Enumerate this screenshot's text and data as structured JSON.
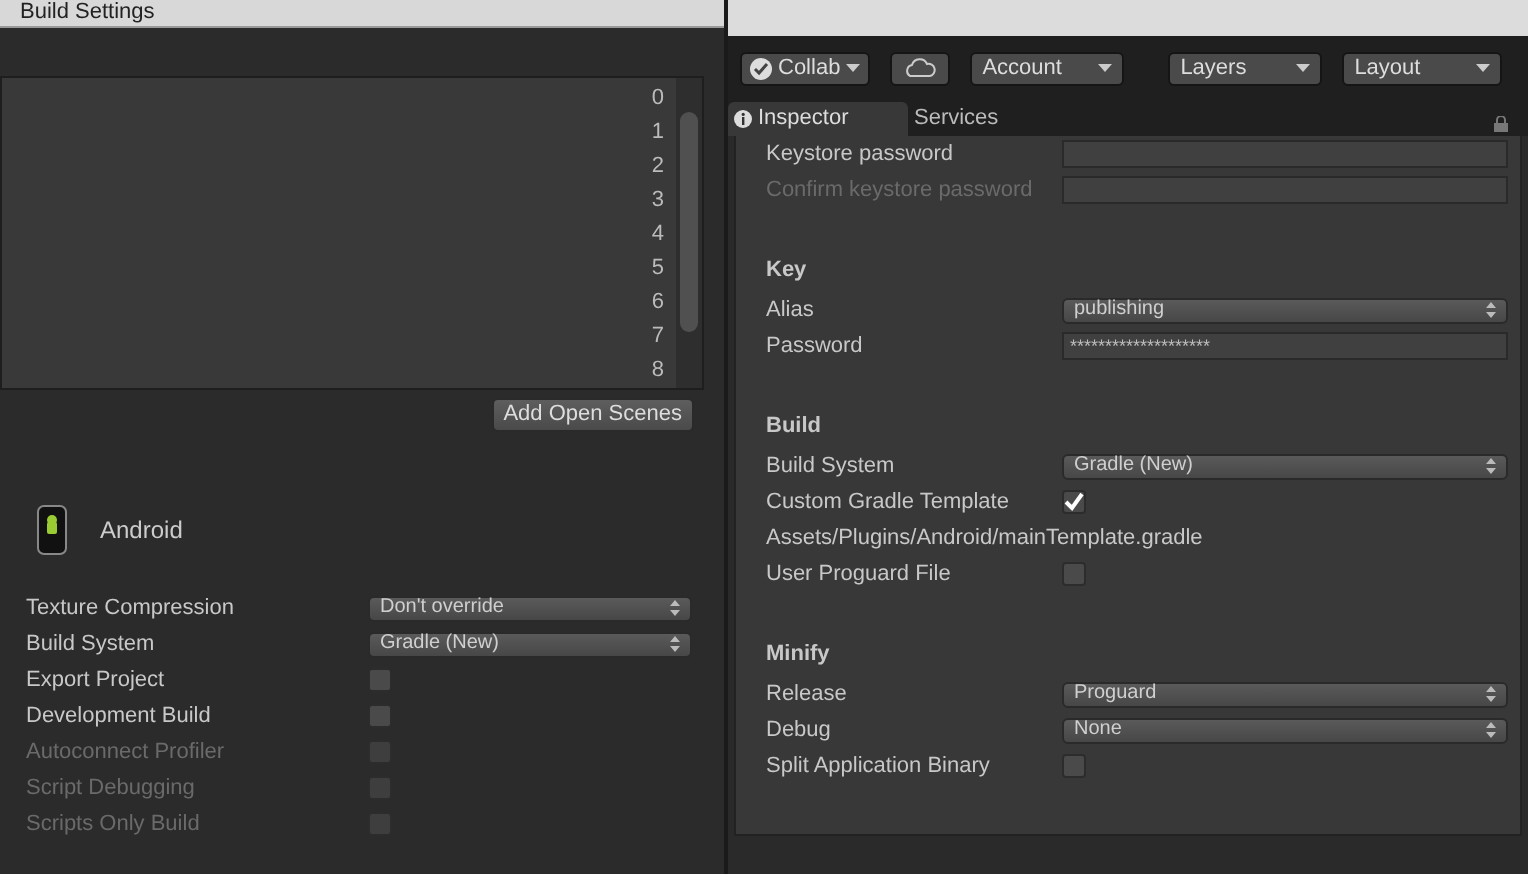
{
  "build_settings": {
    "title": "Build Settings",
    "scene_indices": [
      "0",
      "1",
      "2",
      "3",
      "4",
      "5",
      "6",
      "7",
      "8"
    ],
    "add_open_scenes": "Add Open Scenes",
    "platform": "Android",
    "rows": [
      {
        "kind": "dropdown",
        "label": "Texture Compression",
        "value": "Don't override",
        "disabled": false
      },
      {
        "kind": "dropdown",
        "label": "Build System",
        "value": "Gradle (New)",
        "disabled": false
      },
      {
        "kind": "checkbox",
        "label": "Export Project",
        "checked": false,
        "disabled": false
      },
      {
        "kind": "checkbox",
        "label": "Development Build",
        "checked": false,
        "disabled": false
      },
      {
        "kind": "checkbox",
        "label": "Autoconnect Profiler",
        "checked": false,
        "disabled": true
      },
      {
        "kind": "checkbox",
        "label": "Script Debugging",
        "checked": false,
        "disabled": true
      },
      {
        "kind": "checkbox",
        "label": "Scripts Only Build",
        "checked": false,
        "disabled": true
      }
    ]
  },
  "toolbar": {
    "collab": "Collab",
    "account": "Account",
    "layers": "Layers",
    "layout": "Layout"
  },
  "tabs": [
    {
      "label": "Inspector",
      "selected": true
    },
    {
      "label": "Services",
      "selected": false
    }
  ],
  "inspector": {
    "sections": [
      {
        "rows": [
          {
            "kind": "field",
            "label": "Keystore password",
            "disabled": false
          },
          {
            "kind": "field",
            "label": "Confirm keystore password",
            "disabled": true
          }
        ]
      },
      {
        "header": "Key",
        "rows": [
          {
            "kind": "dropdown",
            "label": "Alias",
            "value": "publishing",
            "disabled": false
          },
          {
            "kind": "field",
            "label": "Password",
            "value": "********************",
            "disabled": false
          }
        ]
      },
      {
        "header": "Build",
        "rows": [
          {
            "kind": "dropdown",
            "label": "Build System",
            "value": "Gradle (New)",
            "disabled": false
          },
          {
            "kind": "checkbox",
            "label": "Custom Gradle Template",
            "checked": true,
            "disabled": false
          },
          {
            "kind": "text",
            "label": "Assets/Plugins/Android/mainTemplate.gradle",
            "disabled": false
          },
          {
            "kind": "checkbox",
            "label": "User Proguard File",
            "checked": false,
            "disabled": false
          }
        ]
      },
      {
        "header": "Minify",
        "rows": [
          {
            "kind": "dropdown",
            "label": "Release",
            "value": "Proguard",
            "disabled": false
          },
          {
            "kind": "dropdown",
            "label": "Debug",
            "value": "None",
            "disabled": false
          },
          {
            "kind": "checkbox",
            "label": "Split Application Binary",
            "checked": false,
            "disabled": false
          }
        ]
      }
    ]
  }
}
